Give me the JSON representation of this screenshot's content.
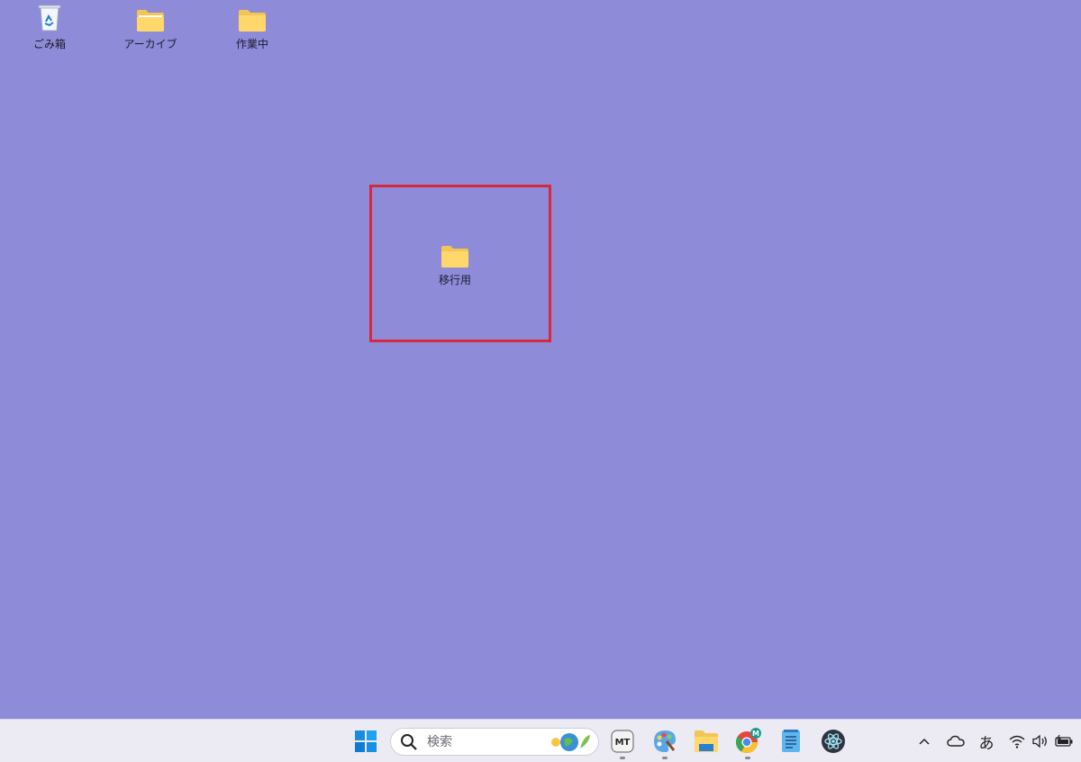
{
  "desktop": {
    "background_color": "#8e8bd8",
    "icons": [
      {
        "label": "ごみ箱",
        "icon": "recycle-bin-icon"
      },
      {
        "label": "アーカイブ",
        "icon": "folder-archive-icon"
      },
      {
        "label": "作業中",
        "icon": "folder-icon"
      },
      {
        "label": "移行用",
        "icon": "folder-icon"
      }
    ],
    "highlight_color": "#d8283c"
  },
  "taskbar": {
    "search": {
      "placeholder": "検索"
    },
    "apps": [
      {
        "name": "windows-start",
        "icon": "windows-logo-icon"
      },
      {
        "name": "mt-app",
        "icon": "mt-app-icon",
        "text": "MT"
      },
      {
        "name": "paint",
        "icon": "paint-palette-icon"
      },
      {
        "name": "file-explorer",
        "icon": "file-explorer-icon"
      },
      {
        "name": "chrome",
        "icon": "chrome-icon",
        "badge": "M"
      },
      {
        "name": "notepad",
        "icon": "notepad-icon"
      },
      {
        "name": "atom-app",
        "icon": "atom-app-icon"
      }
    ],
    "tray": {
      "ime_label": "あ"
    }
  }
}
